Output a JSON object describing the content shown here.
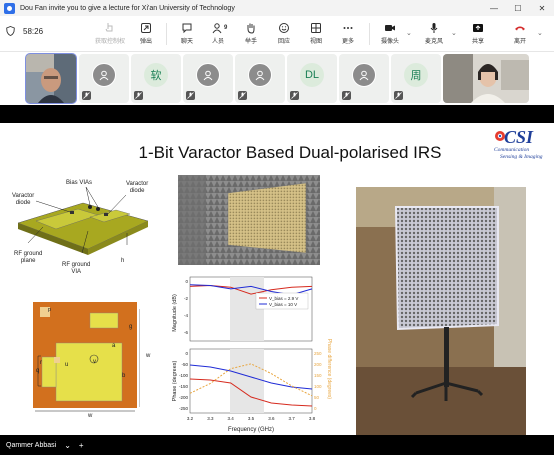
{
  "window": {
    "title": "Dou Fan invite you to give a lecture for Xi'an University of Technology",
    "minimize": "—",
    "maximize": "☐",
    "close": "✕"
  },
  "toolbar": {
    "timer": "58:26",
    "items": {
      "request_control": "获取控制权",
      "eject": "弹出",
      "chat": "聊天",
      "participants": "人员",
      "participant_count": "9",
      "raise_hand": "举手",
      "react": "回应",
      "view": "视图",
      "more": "更多",
      "camera": "摄像头",
      "mic": "麦克风",
      "share": "共享",
      "leave": "离开"
    }
  },
  "participants": [
    {
      "type": "video"
    },
    {
      "type": "icon"
    },
    {
      "type": "text",
      "initials": "软"
    },
    {
      "type": "icon"
    },
    {
      "type": "icon"
    },
    {
      "type": "text",
      "initials": "DL"
    },
    {
      "type": "icon"
    },
    {
      "type": "text",
      "initials": "周"
    },
    {
      "type": "video"
    }
  ],
  "slide": {
    "title": "1-Bit Varactor Based Dual-polarised IRS",
    "logo": {
      "big": "CSI",
      "line1": "Communication",
      "line2": "Sensing & Imaging"
    },
    "diagram_labels": {
      "bias_vias": "Bias VIAs",
      "varactor_diode_left": "Varactor\ndiode",
      "varactor_diode_right": "Varactor\ndiode",
      "rf_ground_plane": "RF ground\nplane",
      "rf_ground_via": "RF ground\nVIA",
      "h": "h"
    },
    "unit_cell_labels": {
      "g": "g",
      "p": "p",
      "r": "r",
      "q": "q",
      "u": "u",
      "a": "a",
      "b": "b",
      "v": "v",
      "w_side": "w",
      "w_bottom": "w"
    },
    "chart_labels": {
      "top_ylabel": "Magnitude (dB)",
      "bottom_ylabel": "Phase (degrees)",
      "right_ylabel": "Phase difference (degrees)",
      "xlabel": "Frequency (GHz)",
      "legend1": "V_bias = 2.9 V",
      "legend2": "V_bias = 10 V"
    }
  },
  "chart_data": {
    "type": "line",
    "xlabel": "Frequency (GHz)",
    "x": [
      3.2,
      3.3,
      3.4,
      3.5,
      3.6,
      3.7,
      3.8
    ],
    "xticks": [
      "3.2",
      "3.3",
      "3.4",
      "3.5",
      "3.6",
      "3.7",
      "3.8"
    ],
    "magnitude_yticks": [
      "0",
      "-2",
      "-4",
      "-6"
    ],
    "phase_yticks": [
      "0",
      "-50",
      "-100",
      "-150",
      "-200",
      "-250"
    ],
    "phase_diff_yticks": [
      "250",
      "200",
      "150",
      "100",
      "50",
      "0"
    ],
    "ylabel_magnitude": "Magnitude (dB)",
    "ylabel_phase": "Phase (degrees)",
    "ylabel_phase_diff": "Phase difference (degrees)",
    "series": [
      {
        "name": "V_bias = 2.9 V",
        "panel": "magnitude",
        "color": "#d62a1e",
        "values": [
          -0.6,
          -0.5,
          -0.7,
          -1.5,
          -1.0,
          -0.7,
          -0.6
        ]
      },
      {
        "name": "V_bias = 10 V",
        "panel": "magnitude",
        "color": "#1f2bd6",
        "values": [
          -0.4,
          -0.5,
          -0.9,
          -0.6,
          -1.2,
          -1.6,
          -0.9
        ]
      },
      {
        "name": "V_bias = 2.9 V",
        "panel": "phase",
        "color": "#d62a1e",
        "values": [
          -130,
          -135,
          -150,
          -220,
          -250,
          -260,
          -265
        ]
      },
      {
        "name": "V_bias = 10 V",
        "panel": "phase",
        "color": "#1f2bd6",
        "values": [
          -60,
          -70,
          -90,
          -120,
          -150,
          -170,
          -180
        ]
      },
      {
        "panel": "phase_diff",
        "color": "#e8a640",
        "values": [
          80,
          120,
          180,
          200,
          160,
          110,
          70
        ]
      }
    ]
  },
  "bottom": {
    "presenter": "Qammer Abbasi",
    "collapse": "⌄",
    "add": "+"
  }
}
